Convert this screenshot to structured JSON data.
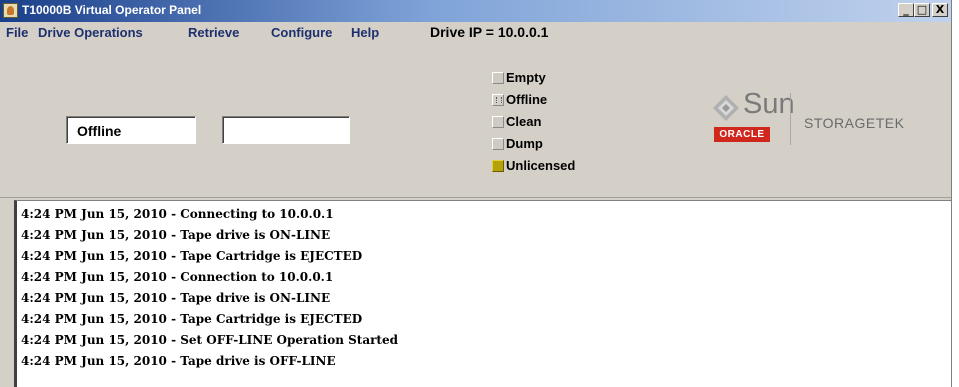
{
  "window": {
    "title": "T10000B Virtual Operator Panel",
    "minimize": "_",
    "maximize": "□",
    "close": "X"
  },
  "menu": {
    "items": [
      "File",
      "Drive Operations",
      "Retrieve",
      "Configure",
      "Help"
    ],
    "drive_ip": "Drive IP = 10.0.0.1"
  },
  "display": {
    "field1": "Offline",
    "field2": ""
  },
  "status": [
    {
      "label": "Empty",
      "state": "off"
    },
    {
      "label": "Offline",
      "state": "active"
    },
    {
      "label": "Clean",
      "state": "off"
    },
    {
      "label": "Dump",
      "state": "off"
    },
    {
      "label": "Unlicensed",
      "state": "on",
      "color": "#b5a20a"
    }
  ],
  "logo": {
    "sun": "Sun",
    "oracle": "ORACLE",
    "storagetek": "STORAGETEK"
  },
  "log": [
    "4:24 PM Jun 15, 2010 - Connecting to 10.0.0.1",
    "4:24 PM Jun 15, 2010 - Tape drive is ON-LINE",
    "4:24 PM Jun 15, 2010 - Tape Cartridge is EJECTED",
    "4:24 PM Jun 15, 2010 - Connection to 10.0.0.1",
    "4:24 PM Jun 15, 2010 - Tape drive is ON-LINE",
    "4:24 PM Jun 15, 2010 - Tape Cartridge is EJECTED",
    "4:24 PM Jun 15, 2010 - Set OFF-LINE Operation Started",
    "4:24 PM Jun 15, 2010 - Tape drive is OFF-LINE"
  ]
}
